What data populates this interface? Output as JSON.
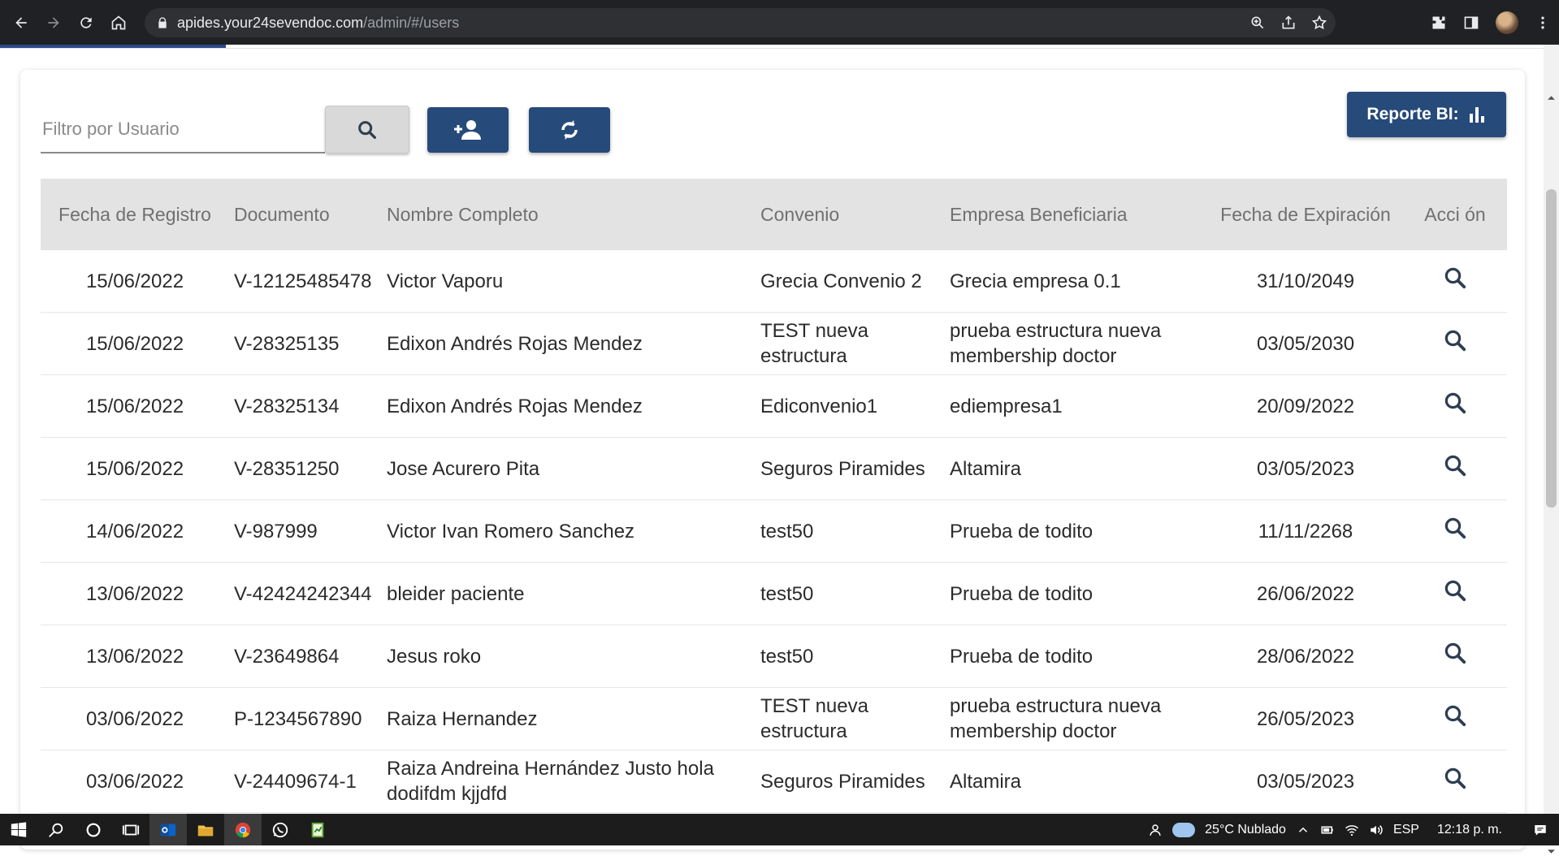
{
  "browser": {
    "url_host": "apides.your24sevendoc.com",
    "url_path": "/admin/#/users"
  },
  "toolbar": {
    "filter_placeholder": "Filtro por Usuario",
    "report_label": "Reporte BI:"
  },
  "table": {
    "headers": [
      "Fecha de Registro",
      "Documento",
      "Nombre Completo",
      "Convenio",
      "Empresa Beneficiaria",
      "Fecha de Expiración",
      "Acci ón"
    ],
    "rows": [
      [
        "15/06/2022",
        "V-12125485478",
        "Victor Vaporu",
        "Grecia Convenio 2",
        "Grecia empresa 0.1",
        "31/10/2049"
      ],
      [
        "15/06/2022",
        "V-28325135",
        "Edixon Andrés Rojas Mendez",
        "TEST nueva estructura",
        "prueba estructura nueva membership doctor",
        "03/05/2030"
      ],
      [
        "15/06/2022",
        "V-28325134",
        "Edixon Andrés Rojas Mendez",
        "Ediconvenio1",
        "ediempresa1",
        "20/09/2022"
      ],
      [
        "15/06/2022",
        "V-28351250",
        "Jose Acurero Pita",
        "Seguros Piramides",
        "Altamira",
        "03/05/2023"
      ],
      [
        "14/06/2022",
        "V-987999",
        "Victor Ivan Romero Sanchez",
        "test50",
        "Prueba de todito",
        "11/11/2268"
      ],
      [
        "13/06/2022",
        "V-42424242344",
        "bleider paciente",
        "test50",
        "Prueba de todito",
        "26/06/2022"
      ],
      [
        "13/06/2022",
        "V-23649864",
        "Jesus roko",
        "test50",
        "Prueba de todito",
        "28/06/2022"
      ],
      [
        "03/06/2022",
        "P-1234567890",
        "Raiza Hernandez",
        "TEST nueva estructura",
        "prueba estructura nueva membership doctor",
        "26/05/2023"
      ],
      [
        "03/06/2022",
        "V-24409674-1",
        "Raiza Andreina Hernández Justo hola dodifdm kjjdfd",
        "Seguros Piramides",
        "Altamira",
        "03/05/2023"
      ]
    ]
  },
  "taskbar": {
    "weather": "25°C Nublado",
    "language": "ESP",
    "time": "12:18 p. m."
  },
  "colors": {
    "primary": "#264a79",
    "header_bg": "#e3e3e3",
    "browser_bg": "#202124",
    "taskbar_bg": "#1c1c1c"
  }
}
